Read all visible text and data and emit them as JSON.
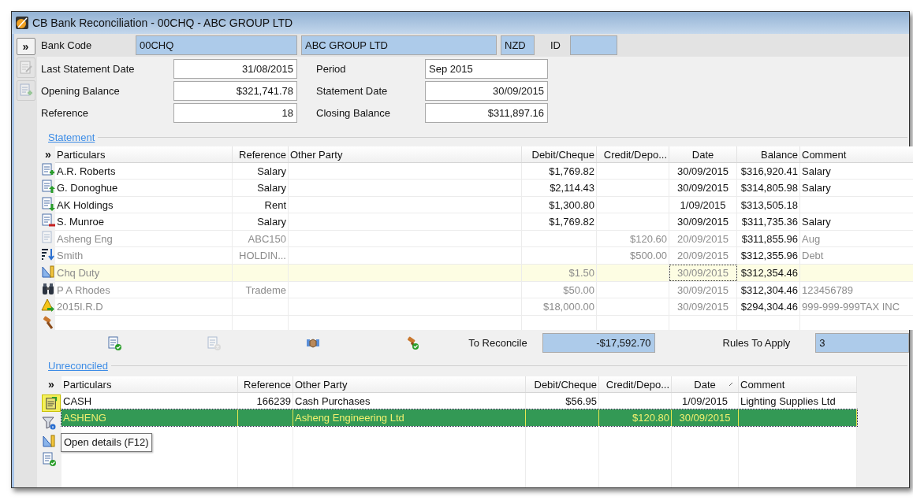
{
  "window": {
    "title": "CB Bank Reconciliation - 00CHQ - ABC GROUP LTD"
  },
  "header": {
    "expand": "»",
    "bank_code_label": "Bank Code",
    "bank_code": "00CHQ",
    "bank_name": "ABC GROUP LTD",
    "currency": "NZD",
    "id_label": "ID"
  },
  "fields_left": [
    {
      "label": "Last Statement Date",
      "value": "31/08/2015"
    },
    {
      "label": "Opening Balance",
      "value": "$321,741.78"
    },
    {
      "label": "Reference",
      "value": "18"
    }
  ],
  "fields_right": [
    {
      "label": "Period",
      "value": "Sep 2015"
    },
    {
      "label": "Statement Date",
      "value": "30/09/2015"
    },
    {
      "label": "Closing Balance",
      "value": "$311,897.16"
    }
  ],
  "statement": {
    "title": "Statement",
    "expand": "»",
    "columns": [
      "Particulars",
      "Reference",
      "Other Party",
      "Debit/Cheque",
      "Credit/Depo...",
      "Date",
      "Balance",
      "Comment"
    ],
    "rows": [
      {
        "particulars": "A.R. Roberts",
        "reference": "Salary",
        "debit": "$1,769.82",
        "date": "30/09/2015",
        "balance": "$316,920.41",
        "comment": "Salary",
        "muted": false,
        "selected": false
      },
      {
        "particulars": "G. Donoghue",
        "reference": "Salary",
        "debit": "$2,114.43",
        "date": "30/09/2015",
        "balance": "$314,805.98",
        "comment": "Salary",
        "muted": false,
        "selected": false
      },
      {
        "particulars": "AK Holdings",
        "reference": "Rent",
        "debit": "$1,300.80",
        "date": "1/09/2015",
        "balance": "$313,505.18",
        "muted": false,
        "selected": false
      },
      {
        "particulars": "S. Munroe",
        "reference": "Salary",
        "debit": "$1,769.82",
        "date": "30/09/2015",
        "balance": "$311,735.36",
        "comment": "Salary",
        "muted": false,
        "selected": false
      },
      {
        "particulars": "Asheng Eng",
        "reference": "ABC150",
        "credit": "$120.60",
        "date": "20/09/2015",
        "balance": "$311,855.96",
        "comment": "Aug",
        "muted": true,
        "selected": false
      },
      {
        "particulars": "Smith",
        "reference": "HOLDIN...",
        "credit": "$500.00",
        "date": "20/09/2015",
        "balance": "$312,355.96",
        "comment": "Debt",
        "muted": true,
        "selected": false
      },
      {
        "particulars": "Chq Duty",
        "debit": "$1.50",
        "date": "30/09/2015",
        "balance": "$312,354.46",
        "muted": true,
        "selected": true
      },
      {
        "particulars": "P A Rhodes",
        "reference": "Trademe",
        "debit": "$50.00",
        "date": "30/09/2015",
        "balance": "$312,304.46",
        "comment": "123456789",
        "muted": true,
        "selected": false
      },
      {
        "particulars": "2015I.R.D",
        "debit": "$18,000.00",
        "date": "30/09/2015",
        "balance": "$294,304.46",
        "comment": "999-999-999TAX INC",
        "muted": true,
        "selected": false
      }
    ]
  },
  "summary": {
    "to_reconcile_label": "To Reconcile",
    "to_reconcile": "-$17,592.70",
    "rules_label": "Rules To Apply",
    "rules": "3"
  },
  "unreconciled": {
    "title": "Unreconciled",
    "expand": "»",
    "columns": [
      {
        "label": "Particulars",
        "sorted": false
      },
      {
        "label": "Reference",
        "sorted": false
      },
      {
        "label": "Other Party",
        "sorted": false
      },
      {
        "label": "Debit/Cheque",
        "sorted": false
      },
      {
        "label": "Credit/Depo...",
        "sorted": false
      },
      {
        "label": "Date",
        "sorted": true
      },
      {
        "label": "Comment",
        "sorted": false
      }
    ],
    "rows": [
      {
        "particulars": "CASH",
        "reference": "166239",
        "other_party": "Cash Purchases",
        "debit": "$56.95",
        "date": "1/09/2015",
        "comment": "Lighting Supplies Ltd",
        "selected": false
      },
      {
        "particulars": "ASHENG",
        "other_party": "Asheng Engineering Ltd",
        "credit": "$120.80",
        "date": "30/09/2015",
        "selected": true
      }
    ]
  },
  "tooltip": "Open details (F12)"
}
